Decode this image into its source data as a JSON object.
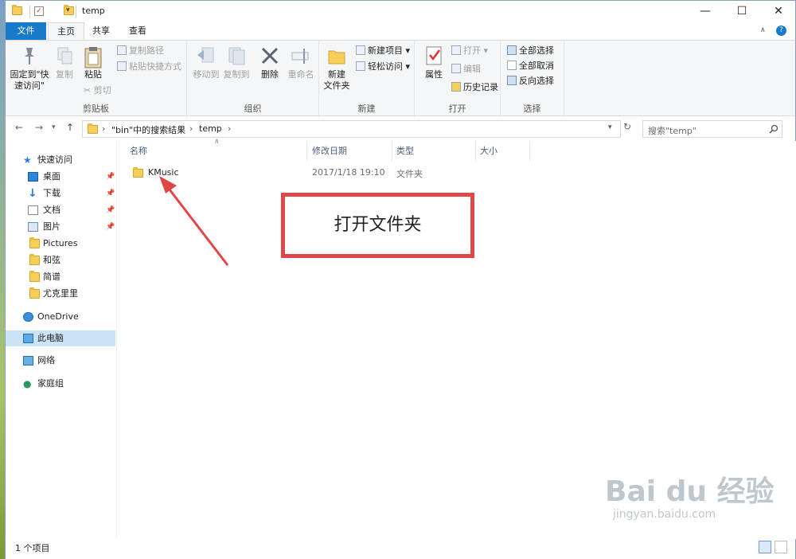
{
  "window": {
    "title": "temp",
    "controls": {
      "minimize": "—",
      "maximize": "☐",
      "close": "✕"
    }
  },
  "ribbon_tabs": [
    "文件",
    "主页",
    "共享",
    "查看"
  ],
  "ribbon": {
    "clipboard": {
      "pin_label_1": "固定到\"快",
      "pin_label_2": "速访问\"",
      "copy_label": "复制",
      "paste_label": "粘贴",
      "copy_path": "复制路径",
      "paste_shortcut": "粘贴快捷方式",
      "cut": "剪切",
      "group_label": "剪贴板"
    },
    "organize": {
      "move_to": "移动到",
      "copy_to": "复制到",
      "delete": "删除",
      "rename": "重命名",
      "group_label": "组织"
    },
    "new": {
      "new_folder_1": "新建",
      "new_folder_2": "文件夹",
      "new_item": "新建项目",
      "easy_access": "轻松访问",
      "group_label": "新建"
    },
    "open": {
      "properties": "属性",
      "open": "打开",
      "edit": "编辑",
      "history": "历史记录",
      "group_label": "打开"
    },
    "select": {
      "select_all": "全部选择",
      "select_none": "全部取消",
      "invert": "反向选择",
      "group_label": "选择"
    }
  },
  "address": {
    "crumb1": "\"bin\"中的搜索结果",
    "crumb2": "temp",
    "search_placeholder": "搜索\"temp\""
  },
  "nav": {
    "quick_access": "快速访问",
    "items": [
      "桌面",
      "下载",
      "文档",
      "图片",
      "Pictures",
      "和弦",
      "简谱",
      "尤克里里"
    ],
    "onedrive": "OneDrive",
    "this_pc": "此电脑",
    "network": "网络",
    "homegroup": "家庭组"
  },
  "columns": [
    "名称",
    "修改日期",
    "类型",
    "大小"
  ],
  "files": [
    {
      "name": "KMusic",
      "modified": "2017/1/18 19:10",
      "type": "文件夹",
      "size": ""
    }
  ],
  "status": {
    "count": "1 个项目"
  },
  "annotation": {
    "callout": "打开文件夹"
  },
  "watermark": {
    "brand": "Bai du 经验",
    "url": "jingyan.baidu.com"
  },
  "colors": {
    "accent": "#1979ca",
    "callout_border": "#e04848",
    "folder": "#f6cf5a",
    "selection": "#cce4f7"
  }
}
